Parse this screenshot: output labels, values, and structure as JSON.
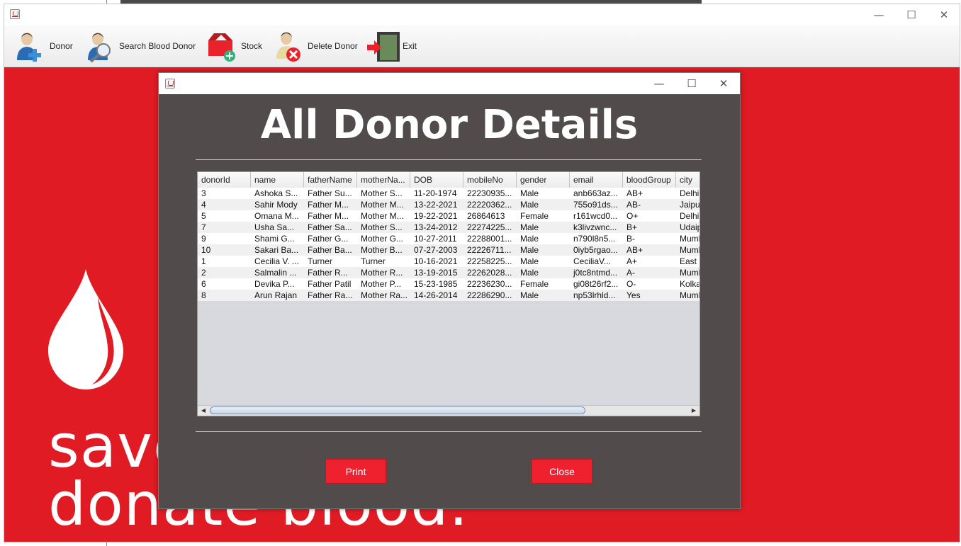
{
  "main_window": {
    "toolbar": [
      {
        "label": "Donor",
        "icon": "donor-add-icon"
      },
      {
        "label": "Search Blood Donor",
        "icon": "search-donor-icon"
      },
      {
        "label": "Stock",
        "icon": "stock-icon"
      },
      {
        "label": "Delete Donor",
        "icon": "delete-donor-icon"
      },
      {
        "label": "Exit",
        "icon": "exit-door-icon"
      }
    ],
    "background_text": {
      "line1": "save",
      "line2": "donate blood."
    }
  },
  "dialog": {
    "title": "All Donor Details",
    "buttons": {
      "print": "Print",
      "close": "Close"
    },
    "table": {
      "columns": [
        "donorId",
        "name",
        "fatherName",
        "motherNa...",
        "DOB",
        "mobileNo",
        "gender",
        "email",
        "bloodGroup",
        "city"
      ],
      "rows": [
        [
          "3",
          "Ashoka  S...",
          "Father  Su...",
          "Mother  S...",
          "11-20-1974",
          "22230935...",
          "Male",
          "anb663az...",
          "AB+",
          "Delhi"
        ],
        [
          "4",
          "Sahir  Mody",
          "Father  M...",
          "Mother  M...",
          "13-22-2021",
          "22220362...",
          "Male",
          "755o91ds...",
          "AB-",
          "Jaipur"
        ],
        [
          "5",
          "Omana  M...",
          "Father  M...",
          "Mother  M...",
          "19-22-2021",
          "26864613",
          "Female",
          "r161wcd0...",
          "O+",
          " Delhi"
        ],
        [
          "7",
          "Usha  Sa...",
          "Father  Sa...",
          "Mother  S...",
          "13-24-2012",
          "22274225...",
          "Male",
          "k3livzwnc...",
          "B+",
          "Udaipur"
        ],
        [
          "9",
          "Shami  G...",
          "Father  G...",
          "Mother  G...",
          "10-27-2011",
          "22288001...",
          "Male",
          "n790l8n5...",
          "B-",
          " Mumbai"
        ],
        [
          "10",
          "Sakari  Ba...",
          "Father  Ba...",
          "Mother  B...",
          "07-27-2003",
          "22226711...",
          "Male",
          "0iyb5rgao...",
          "AB+",
          " Mumbai"
        ],
        [
          "1",
          "Cecilia V. ...",
          "Turner",
          "Turner",
          "10-16-2021",
          "22258225...",
          "Male",
          " CeciliaV...",
          "A+",
          "East"
        ],
        [
          "2",
          "Salmalin  ...",
          "Father  R...",
          "Mother  R...",
          "13-19-2015",
          "22262028...",
          "Male",
          "j0tc8ntmd...",
          "A-",
          " Mumbai"
        ],
        [
          "6",
          "Devika  P...",
          "Father  Patil",
          "Mother  P...",
          "15-23-1985",
          "22236230...",
          "Female",
          "gi08t26rf2...",
          "O-",
          "Kolkata"
        ],
        [
          "8",
          "Arun  Rajan",
          "Father Ra...",
          "Mother Ra...",
          "14-26-2014",
          "22286290...",
          "Male",
          "np53lrhld...",
          "Yes",
          " Mumbai"
        ]
      ]
    }
  }
}
